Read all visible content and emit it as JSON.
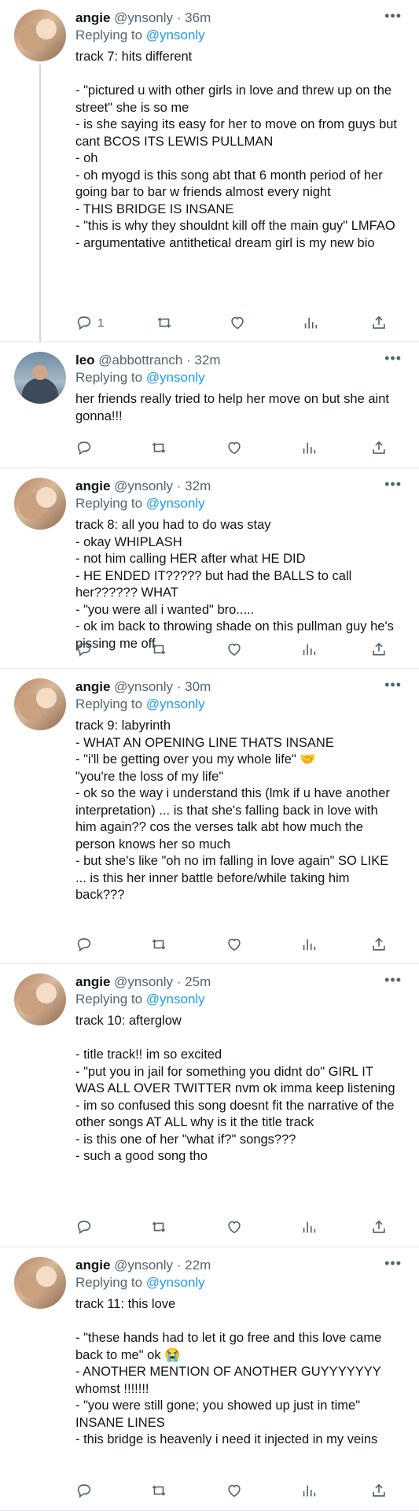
{
  "tweets": [
    {
      "name": "angie",
      "handle": "@ynsonly",
      "time": "· 36m",
      "replying_to_prefix": "Replying to ",
      "replying_to": "@ynsonly",
      "avatar": "angie",
      "lines": [
        "track 7: hits different",
        "",
        "- \"pictured u with other girls in love and threw up on the street\" she is so me",
        "- is she saying its easy for her to move on from guys but cant BCOS ITS LEWIS PULLMAN",
        "- oh",
        "- oh myogd is this song abt that 6 month period of her going bar to bar w friends almost every night",
        "- THIS BRIDGE IS INSANE",
        "- \"this is why they shouldnt kill off the main guy\" LMFAO",
        "- argumentative antithetical dream girl is my new bio"
      ],
      "reply_count": "1",
      "retweet_count": "",
      "like_count": ""
    },
    {
      "name": "leo",
      "handle": "@abbottranch",
      "time": "· 32m",
      "replying_to_prefix": "Replying to ",
      "replying_to": "@ynsonly",
      "avatar": "leo",
      "lines": [
        "her friends really tried to help her move on but she aint gonna!!!"
      ],
      "reply_count": "",
      "retweet_count": "",
      "like_count": ""
    },
    {
      "name": "angie",
      "handle": "@ynsonly",
      "time": "· 32m",
      "replying_to_prefix": "Replying to ",
      "replying_to": "@ynsonly",
      "avatar": "angie",
      "lines": [
        "track 8: all you had to do was stay",
        "- okay WHIPLASH",
        "- not him calling HER after what HE DID",
        "- HE ENDED IT????? but had the BALLS to call her?????? WHAT",
        "- \"you were all i wanted\" bro.....",
        "- ok im back to throwing shade on this pullman guy he's pissing me off"
      ],
      "reply_count": "",
      "retweet_count": "",
      "like_count": ""
    },
    {
      "name": "angie",
      "handle": "@ynsonly",
      "time": "· 30m",
      "replying_to_prefix": "Replying to ",
      "replying_to": "@ynsonly",
      "avatar": "angie",
      "lines": [
        "track 9: labyrinth",
        "- WHAT AN OPENING LINE THATS INSANE",
        "- \"i'll be getting over you my whole life\" 🤝",
        "\"you're the loss of my life\"",
        "- ok so the way i understand this (lmk if u have another interpretation) ... is that she's falling back in love with him again?? cos the verses talk abt how much the person knows her so much",
        "- but she's like \"oh no im falling in love again\" SO LIKE ... is this her inner battle before/while taking him back???"
      ],
      "reply_count": "",
      "retweet_count": "",
      "like_count": ""
    },
    {
      "name": "angie",
      "handle": "@ynsonly",
      "time": "· 25m",
      "replying_to_prefix": "Replying to ",
      "replying_to": "@ynsonly",
      "avatar": "angie",
      "lines": [
        "track 10: afterglow",
        "",
        "- title track!! im so excited",
        "- \"put you in jail for something you didnt do\" GIRL IT WAS ALL OVER TWITTER nvm ok imma keep listening",
        "- im so confused this song doesnt fit the narrative of the other songs AT ALL why is it the title track",
        "- is this one of her \"what if?\" songs???",
        "- such a good song tho"
      ],
      "reply_count": "",
      "retweet_count": "",
      "like_count": ""
    },
    {
      "name": "angie",
      "handle": "@ynsonly",
      "time": "· 22m",
      "replying_to_prefix": "Replying to ",
      "replying_to": "@ynsonly",
      "avatar": "angie",
      "lines": [
        "track 11: this love",
        "",
        "- \"these hands had to let it go free and this love came back to me\" ok 😭",
        "- ANOTHER MENTION OF ANOTHER GUYYYYYYY whomst !!!!!!!",
        "- \"you were still gone; you showed up just in time\" INSANE LINES",
        "- this bridge is heavenly i need it injected in my veins"
      ],
      "reply_count": "",
      "retweet_count": "",
      "like_count": ""
    }
  ],
  "icons": {
    "reply": "reply-icon",
    "retweet": "retweet-icon",
    "like": "like-icon",
    "analytics": "analytics-icon",
    "share": "share-icon",
    "more": "more-options-icon"
  },
  "colors": {
    "link": "#1d9bf0",
    "muted": "#536471",
    "text": "#0f1419",
    "divider": "#e1e6ea"
  }
}
